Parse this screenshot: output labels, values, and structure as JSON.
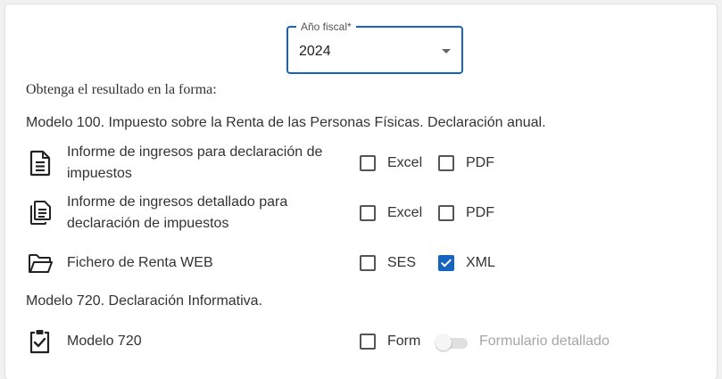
{
  "fiscal_year": {
    "label": "Año fiscal*",
    "value": "2024"
  },
  "intro_text": "Obtenga el resultado en la forma:",
  "sections": [
    {
      "title": "Modelo 100. Impuesto sobre la Renta de las Personas Físicas. Declaración anual.",
      "rows": [
        {
          "icon": "document-icon",
          "label": "Informe de ingresos para declaración de impuestos",
          "options": [
            {
              "label": "Excel",
              "checked": false
            },
            {
              "label": "PDF",
              "checked": false
            }
          ]
        },
        {
          "icon": "documents-stack-icon",
          "label": "Informe de ingresos detallado para declaración de impuestos",
          "options": [
            {
              "label": "Excel",
              "checked": false
            },
            {
              "label": "PDF",
              "checked": false
            }
          ]
        },
        {
          "icon": "folder-open-icon",
          "label": "Fichero de Renta WEB",
          "options": [
            {
              "label": "SES",
              "checked": false
            },
            {
              "label": "XML",
              "checked": true
            }
          ]
        }
      ]
    },
    {
      "title": "Modelo 720. Declaración Informativa.",
      "rows": [
        {
          "icon": "clipboard-check-icon",
          "label": "Modelo 720",
          "options": [
            {
              "label": "Form",
              "checked": false
            }
          ],
          "toggle": {
            "label": "Formulario detallado",
            "on": false,
            "disabled": true
          }
        }
      ]
    }
  ],
  "colors": {
    "accent": "#1565c0",
    "text": "#333333",
    "disabled": "#a6a6a6"
  }
}
